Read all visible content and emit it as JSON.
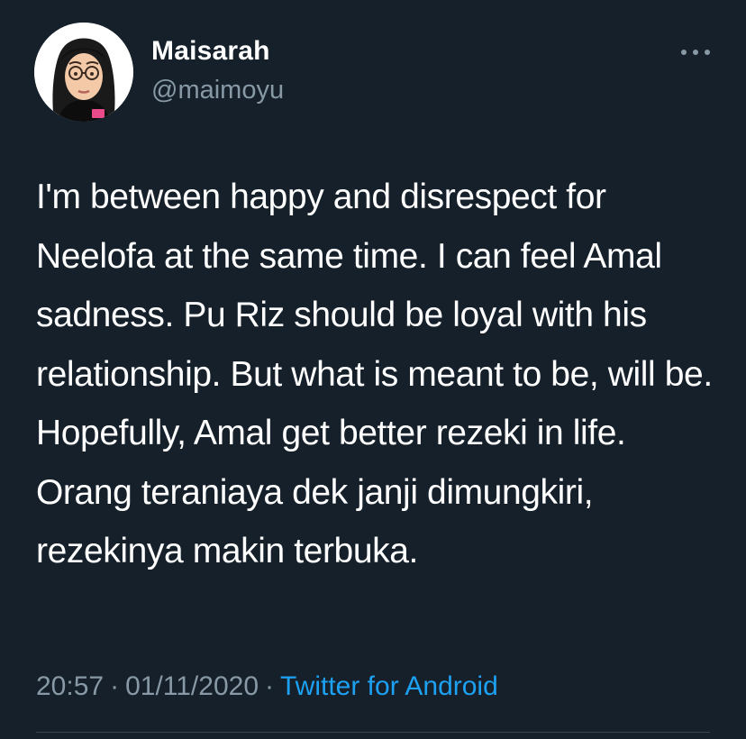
{
  "tweet": {
    "author": {
      "display_name": "Maisarah",
      "handle": "@maimoyu",
      "avatar_icon": "bitmoji-avatar"
    },
    "more_icon": "more-options-icon",
    "text": "I'm between happy and disrespect for Neelofa at the same time. I can feel Amal sadness. Pu Riz should be loyal with his relationship. But what is meant to be, will be. Hopefully, Amal get better rezeki in life. Orang teraniaya dek janji dimungkiri, rezekinya makin terbuka.",
    "time": "20:57",
    "date": "01/11/2020",
    "separator": "·",
    "source": "Twitter for Android"
  },
  "colors": {
    "background": "#15202b",
    "text_primary": "#ffffff",
    "text_secondary": "#8899a6",
    "link": "#1da1f2",
    "divider": "#38444d"
  }
}
